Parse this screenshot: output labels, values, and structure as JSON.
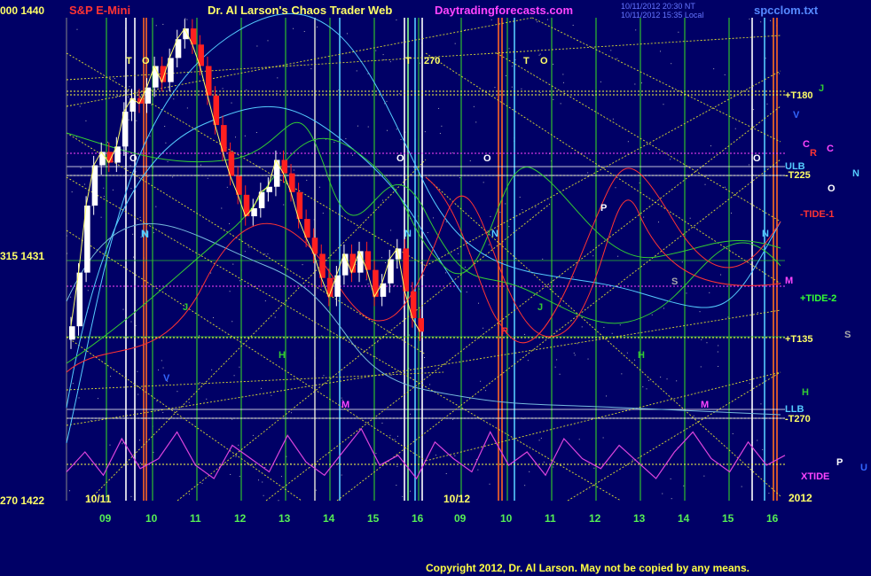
{
  "header": {
    "product": "S&P E-Mini",
    "title": "Dr. Al Larson's Chaos Trader Web",
    "site": "Daytradingforecasts.com",
    "stamp1": "10/11/2012 20:30 NT",
    "stamp2": "10/11/2012 15:35 Local",
    "file": "spcclom.txt"
  },
  "left_axis": [
    {
      "label": "000",
      "value": "1440"
    },
    {
      "label": "315",
      "value": "1431"
    },
    {
      "label": "270",
      "value": "1422"
    }
  ],
  "right_labels": {
    "t180": "+T180",
    "j": "J",
    "v": "V",
    "r": "R",
    "c": "C",
    "ulb_top": "ULB",
    "n": "N",
    "t225": "-T225",
    "o": "O",
    "tide1": "-TIDE-1",
    "m": "M",
    "tide2": "+TIDE-2",
    "t135": "+T135",
    "s": "S",
    "h": "H",
    "llb": "LLB",
    "t270": "-T270",
    "p": "P",
    "u": "U",
    "xtide": "XTIDE",
    "year": "2012"
  },
  "date_labels": [
    "10/11",
    "10/12"
  ],
  "colors": {
    "background": "#000066",
    "candle_up": "#ffffff",
    "candle_down": "#ff2020",
    "grid_green": "#33cc33",
    "grid_yellow": "#ffff00",
    "grid_magenta": "#ff44ff",
    "xtide": "#dd44dd",
    "cyan": "#55ccff"
  },
  "chart_data": {
    "type": "candlestick",
    "title": "S&P E-Mini",
    "ylim": [
      1422,
      1440
    ],
    "y_ticks": [
      1422,
      1431,
      1440
    ],
    "x_ticks": [
      "09",
      "10",
      "11",
      "12",
      "13",
      "14",
      "15",
      "16",
      "09",
      "10",
      "11",
      "12",
      "13",
      "14",
      "15",
      "16"
    ],
    "closes": [
      1428.5,
      1430.5,
      1433,
      1434.5,
      1435,
      1434.6,
      1435.2,
      1436.5,
      1437,
      1436.8,
      1437.4,
      1438.2,
      1437.6,
      1438.5,
      1439.2,
      1439.6,
      1439,
      1438.2,
      1437.1,
      1436,
      1435,
      1434.1,
      1433.4,
      1432.6,
      1432.9,
      1433.5,
      1433.7,
      1434.7,
      1434.2,
      1433.5,
      1432.5,
      1431.8,
      1431.2,
      1430.3,
      1429.6,
      1430.4,
      1431.2,
      1430.5,
      1431.3,
      1430.6,
      1429.6,
      1430.1,
      1431,
      1431.4,
      1429.8,
      1428.8,
      1428.3
    ],
    "overlay_labels": [
      "T",
      "O",
      "T",
      "270",
      "T",
      "O",
      "O",
      "O",
      "O",
      "O",
      "N",
      "N",
      "N",
      "N",
      "N",
      "J",
      "J",
      "H",
      "H",
      "M",
      "M",
      "V",
      "R",
      "P",
      "S",
      "C"
    ],
    "xtide": [
      0.3,
      0.6,
      0.25,
      0.8,
      0.35,
      0.5,
      0.9,
      0.4,
      0.2,
      0.7,
      0.5,
      0.3,
      0.85,
      0.45,
      0.25,
      0.6,
      0.95,
      0.4,
      0.55,
      0.2,
      0.75,
      0.5,
      0.3,
      0.9,
      0.4,
      0.6,
      0.25,
      0.8,
      0.5,
      0.35,
      0.7,
      0.45,
      0.2,
      0.6,
      0.9,
      0.5,
      0.3,
      0.75,
      0.4,
      0.55
    ]
  },
  "footer": {
    "copyright": "Copyright 2012, Dr. Al Larson. May not be copied by any means."
  }
}
